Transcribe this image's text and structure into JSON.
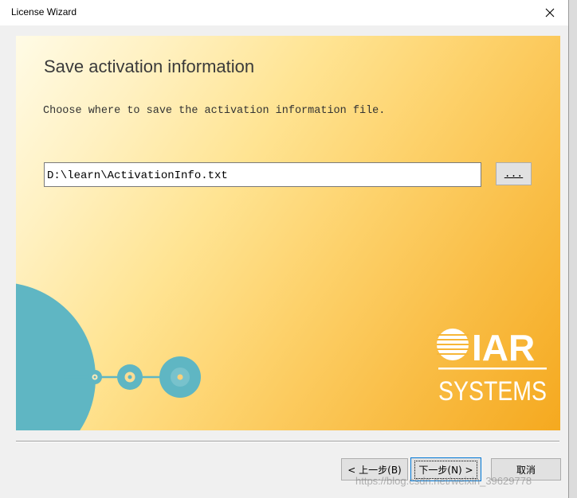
{
  "window": {
    "title": "License Wizard"
  },
  "page": {
    "heading": "Save activation information",
    "description": "Choose where to save the activation information file.",
    "file_path": "D:\\learn\\ActivationInfo.txt",
    "browse_label": "..."
  },
  "logo": {
    "line1": "IAR",
    "line2": "SYSTEMS"
  },
  "buttons": {
    "back": "< 上一步(B)",
    "next": "下一步(N) >",
    "cancel": "取消"
  },
  "watermark": "https://blog.csdn.net/weixin_39629778",
  "colors": {
    "accent_start": "#fffbe6",
    "accent_end": "#f5a91f",
    "teal": "#5fb6c3",
    "focus": "#0078d7"
  }
}
